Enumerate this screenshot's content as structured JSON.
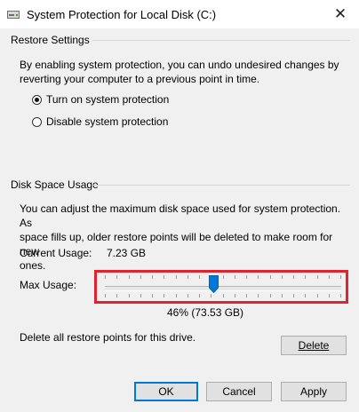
{
  "window": {
    "title": "System Protection for Local Disk (C:)",
    "close_glyph": "✕",
    "icon": "drive-icon"
  },
  "restore_settings": {
    "header": "Restore Settings",
    "description_line1": "By enabling system protection, you can undo undesired changes by",
    "description_line2": "reverting your computer to a previous point in time.",
    "options": [
      {
        "label": "Turn on system protection",
        "selected": true
      },
      {
        "label": "Disable system protection",
        "selected": false
      }
    ]
  },
  "disk_space": {
    "header": "Disk Space Usage",
    "description_line1": "You can adjust the maximum disk space used for system protection. As",
    "description_line2": "space fills up, older restore points will be deleted to make room for new",
    "description_line3": "ones.",
    "current_usage_label": "Current Usage:",
    "current_usage_value": "7.23 GB",
    "max_usage_label": "Max Usage:",
    "max_usage_fraction": 0.46,
    "max_usage_value": "46% (73.53 GB)",
    "delete_text": "Delete all restore points for this drive.",
    "delete_button": "Delete"
  },
  "footer": {
    "ok": "OK",
    "cancel": "Cancel",
    "apply": "Apply"
  },
  "colors": {
    "highlight": "#e0242f",
    "thumb": "#0078d7"
  }
}
